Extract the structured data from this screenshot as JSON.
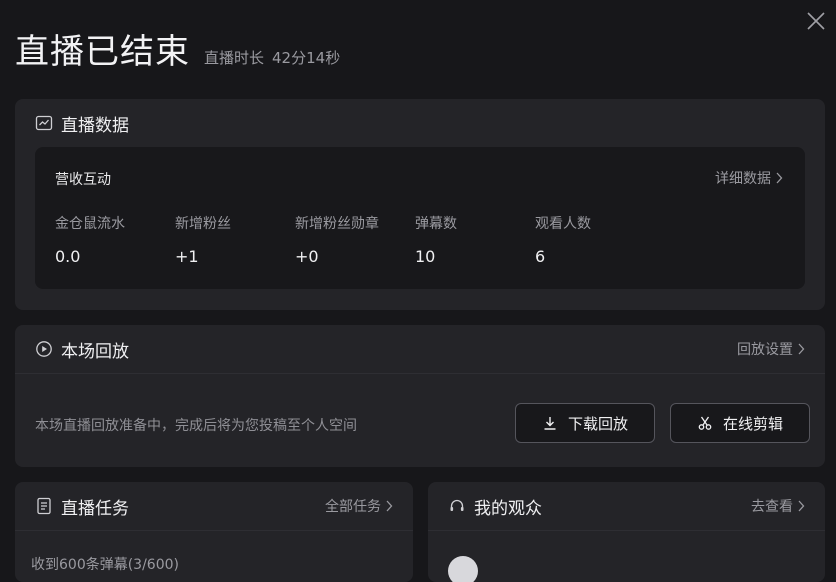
{
  "header": {
    "title": "直播已结束",
    "duration_label": "直播时长",
    "duration_value": "42分14秒"
  },
  "live_data": {
    "title": "直播数据",
    "section_title": "营收互动",
    "detail_link": "详细数据",
    "metrics": [
      {
        "label": "金仓鼠流水",
        "value": "0.0"
      },
      {
        "label": "新增粉丝",
        "value": "+1"
      },
      {
        "label": "新增粉丝勋章",
        "value": "+0"
      },
      {
        "label": "弹幕数",
        "value": "10"
      },
      {
        "label": "观看人数",
        "value": "6"
      }
    ]
  },
  "replay": {
    "title": "本场回放",
    "settings_link": "回放设置",
    "status_text": "本场直播回放准备中，完成后将为您投稿至个人空间",
    "download_label": "下载回放",
    "edit_label": "在线剪辑"
  },
  "tasks": {
    "title": "直播任务",
    "all_link": "全部任务",
    "first_item": "收到600条弹幕(3/600)"
  },
  "audience": {
    "title": "我的观众",
    "view_link": "去查看"
  },
  "icons": {
    "close": "close-icon",
    "chart": "chart-icon",
    "play": "play-circle-icon",
    "download": "download-icon",
    "scissors": "scissors-icon",
    "document": "document-icon",
    "headset": "audience-icon",
    "chevron": "chevron-right-icon"
  }
}
